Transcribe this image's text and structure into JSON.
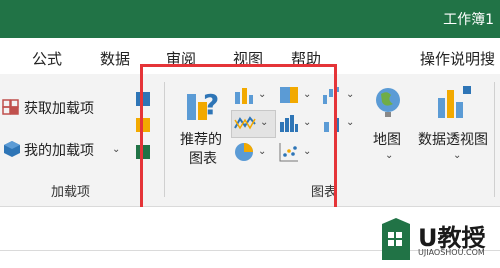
{
  "window": {
    "title": "工作簿1"
  },
  "tabs": [
    "公式",
    "数据",
    "审阅",
    "视图",
    "帮助",
    "操作说明搜"
  ],
  "addins_group": {
    "get_addins": "获取加载项",
    "my_addins": "我的加载项",
    "group_label": "加载项"
  },
  "charts_group": {
    "recommended_line1": "推荐的",
    "recommended_line2": "图表",
    "group_label": "图表"
  },
  "map": {
    "label": "地图"
  },
  "pivot_chart": {
    "label": "数据透视图"
  },
  "watermark": {
    "brand": "U教授",
    "url": "UJIAOSHOU.COM"
  },
  "colors": {
    "excel_green": "#217346",
    "highlight_red": "#e53438",
    "ribbon_bg": "#f3f3f3"
  }
}
